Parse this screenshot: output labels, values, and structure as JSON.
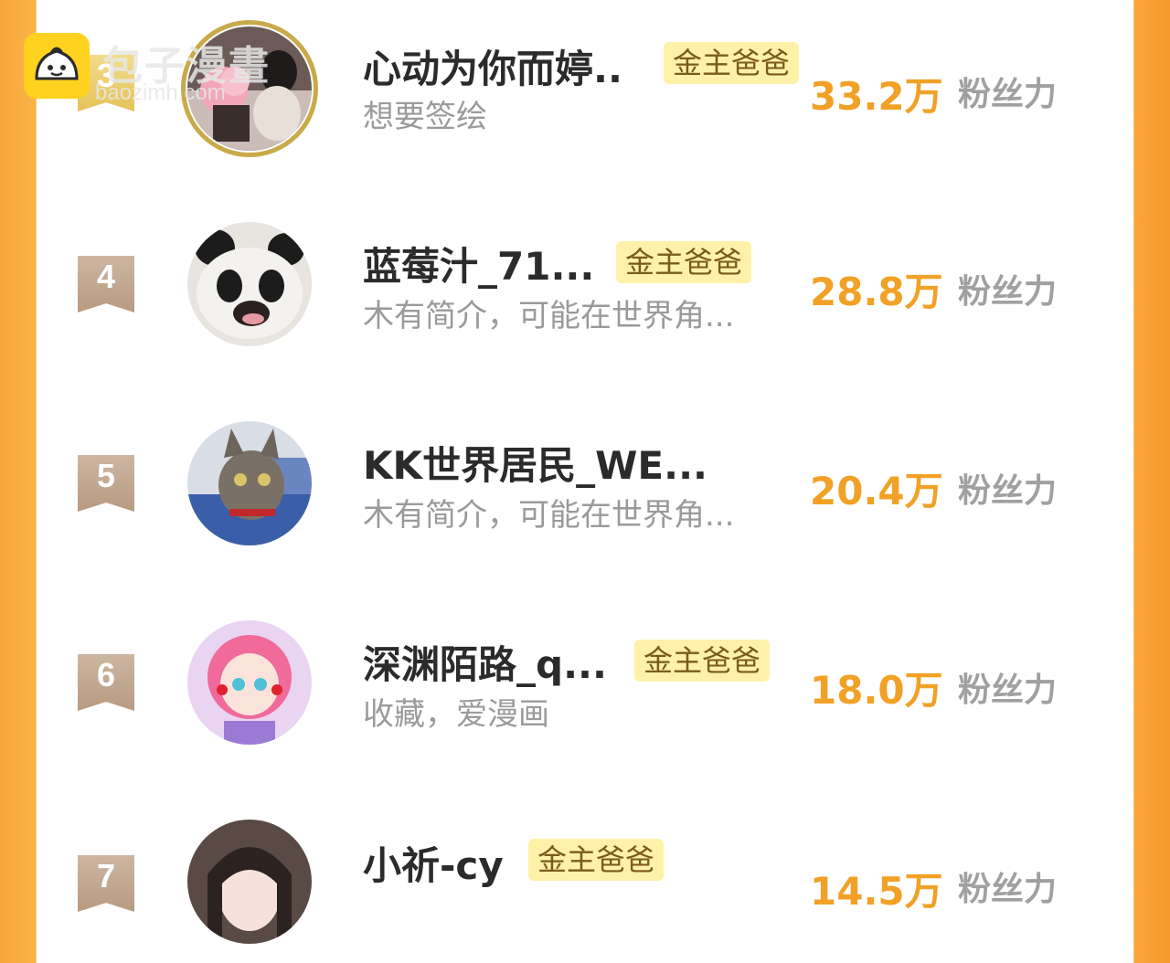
{
  "watermark": {
    "title": "包子漫畫",
    "subtitle": "baozimh.com"
  },
  "badge_label": "金主爸爸",
  "fans_label": "粉丝力",
  "rows": [
    {
      "rank": "3",
      "name": "心动为你而婷..",
      "badge": "金主爸爸",
      "bio": "想要签绘",
      "score": "33.2万"
    },
    {
      "rank": "4",
      "name": "蓝莓汁_71...",
      "badge": "金主爸爸",
      "bio": "木有简介，可能在世界角...",
      "score": "28.8万"
    },
    {
      "rank": "5",
      "name": "KK世界居民_WE...",
      "badge": "",
      "bio": "木有简介，可能在世界角...",
      "score": "20.4万"
    },
    {
      "rank": "6",
      "name": "深渊陌路_q...",
      "badge": "金主爸爸",
      "bio": "收藏，爱漫画",
      "score": "18.0万"
    },
    {
      "rank": "7",
      "name": "小祈-cy",
      "badge": "金主爸爸",
      "bio": "",
      "score": "14.5万"
    }
  ],
  "colors": {
    "accent": "#f2a127",
    "badge_bg": "#fff1a8",
    "side": "#f7a53a"
  }
}
